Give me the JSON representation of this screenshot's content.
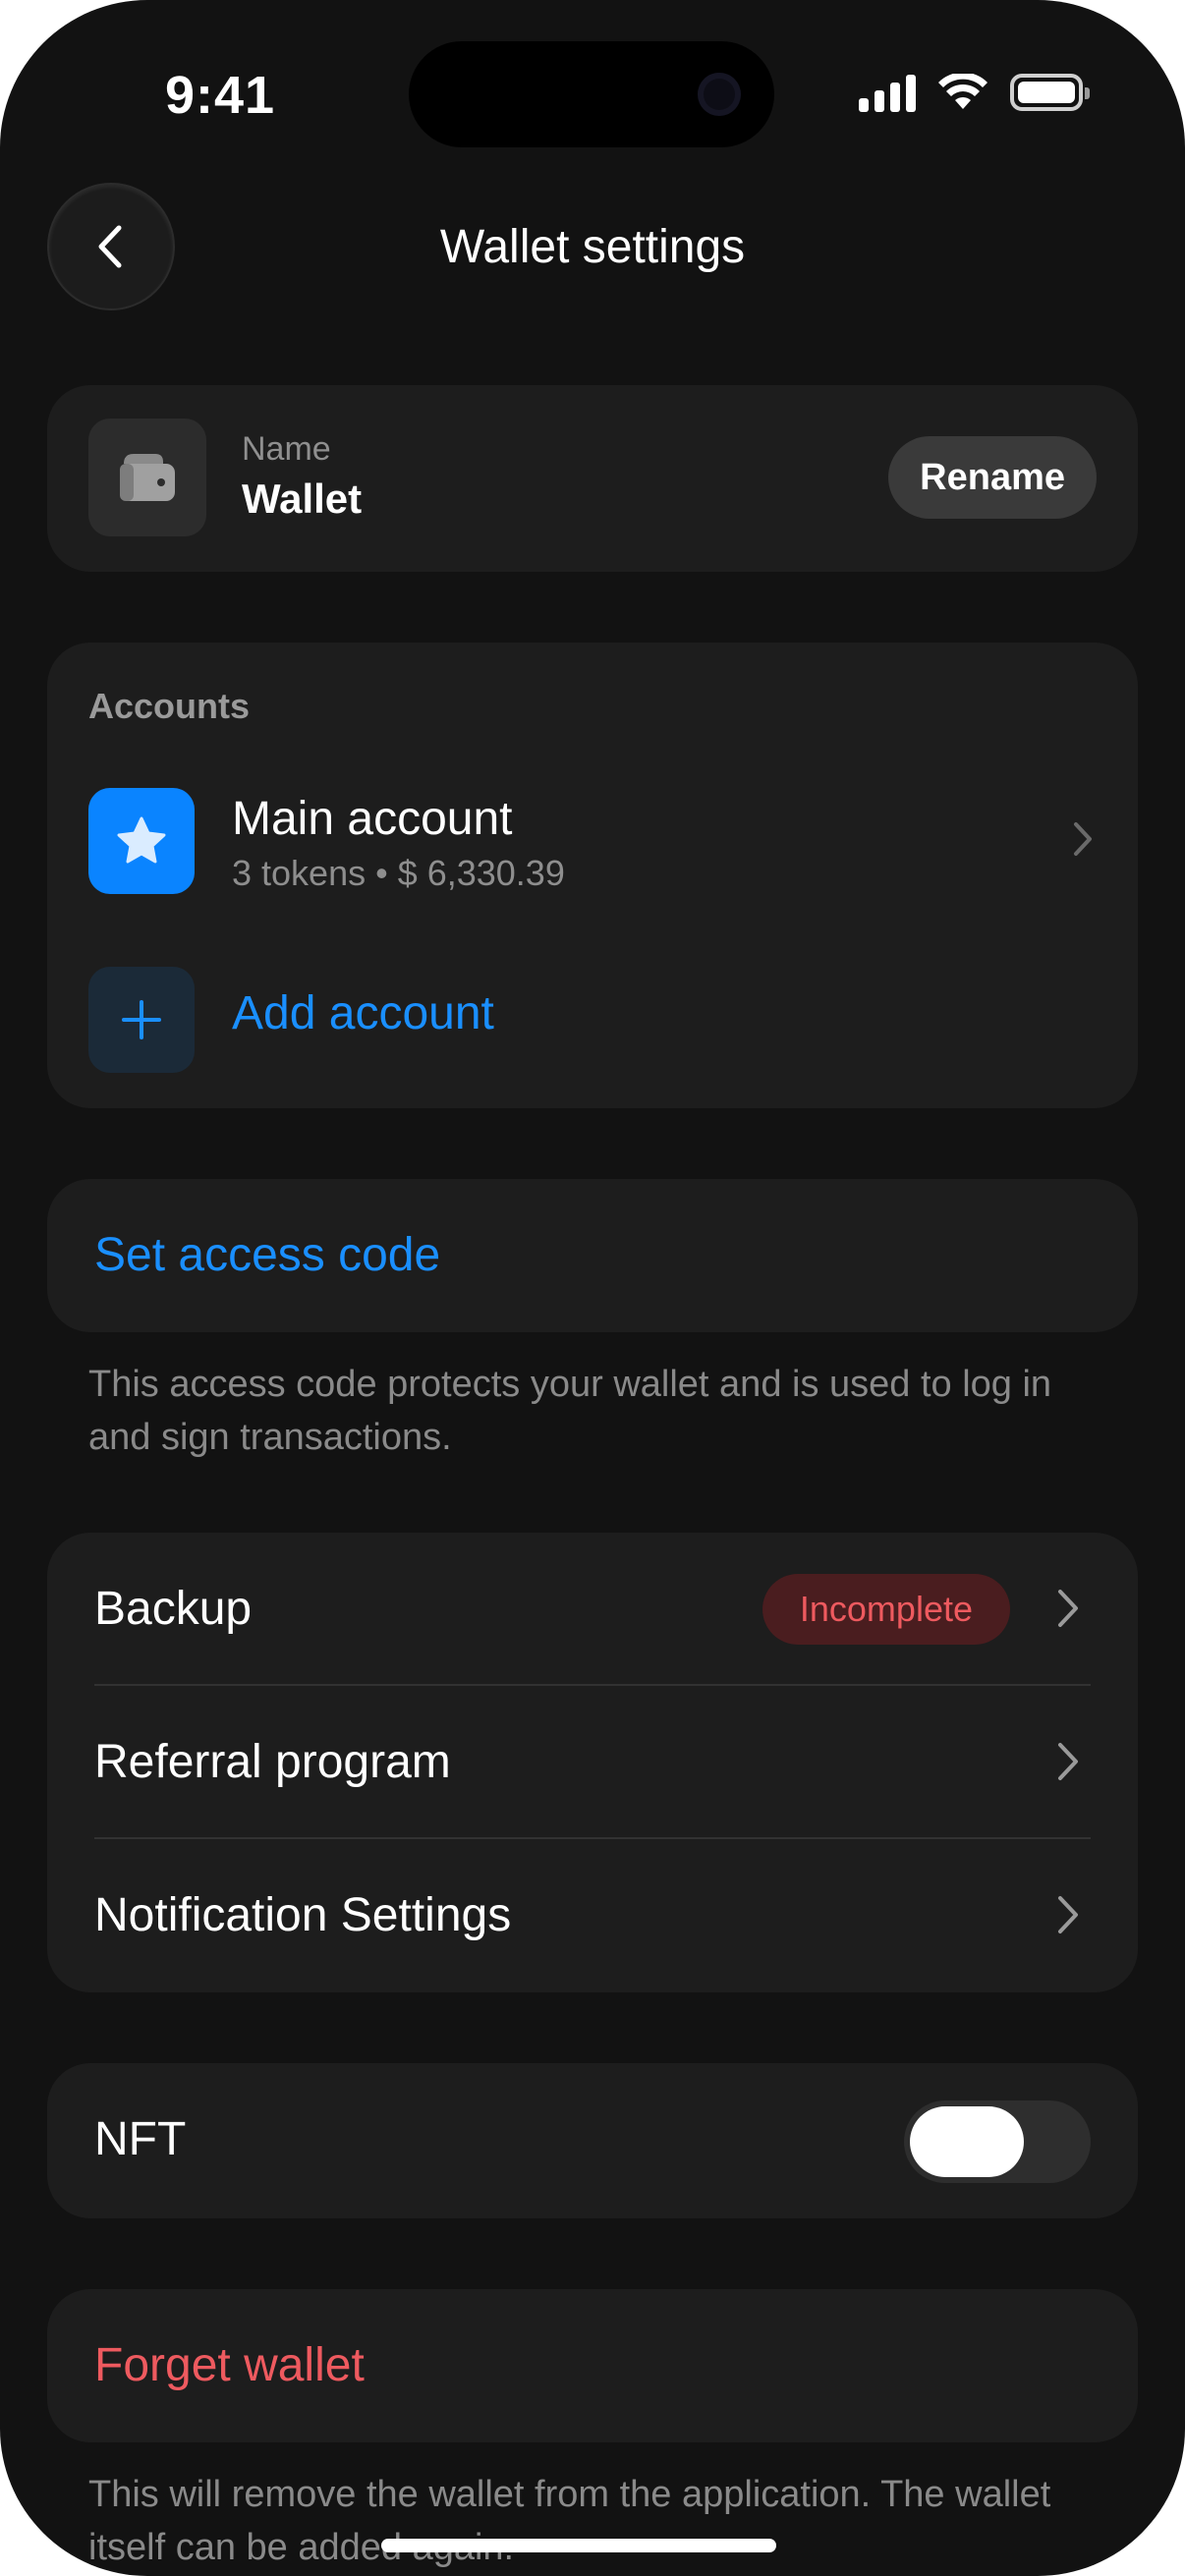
{
  "status_bar": {
    "time": "9:41"
  },
  "header": {
    "title": "Wallet settings"
  },
  "name_card": {
    "label": "Name",
    "value": "Wallet",
    "rename_label": "Rename"
  },
  "accounts": {
    "section_label": "Accounts",
    "main": {
      "name": "Main account",
      "subtitle": "3 tokens • $ 6,330.39"
    },
    "add_label": "Add account"
  },
  "access_code": {
    "label": "Set access code",
    "caption": "This access code protects your wallet and is used to log in and sign transactions."
  },
  "settings": {
    "backup": {
      "label": "Backup",
      "badge": "Incomplete"
    },
    "referral": {
      "label": "Referral program"
    },
    "notifications": {
      "label": "Notification Settings"
    }
  },
  "nft": {
    "label": "NFT",
    "enabled": true
  },
  "forget": {
    "label": "Forget wallet",
    "caption": "This will remove the wallet from the application. The wallet itself can be added again."
  },
  "colors": {
    "background": "#121212",
    "card": "#1d1d1d",
    "accent": "#0a84ff",
    "danger": "#ee5a5f"
  },
  "icons": [
    "back-chevron-icon",
    "wallet-icon",
    "star-icon",
    "plus-icon",
    "chevron-right-icon"
  ]
}
